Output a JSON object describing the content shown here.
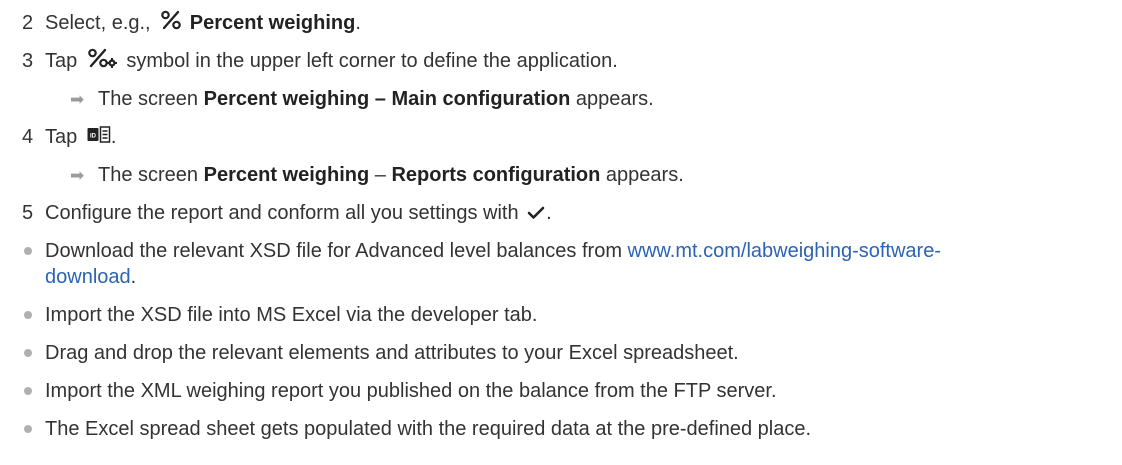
{
  "steps": [
    {
      "number": "2",
      "text_before": "Select, e.g.,",
      "icon": "percent-icon",
      "bold": "Percent weighing",
      "text_after": "."
    },
    {
      "number": "3",
      "text_before": "Tap",
      "icon": "percent-settings-icon",
      "text_after": "symbol in the upper left corner to define the application.",
      "result": {
        "prefix": "The screen",
        "bold": "Percent weighing – Main configuration",
        "suffix": "appears."
      }
    },
    {
      "number": "4",
      "text_before": "Tap",
      "icon": "report-id-icon",
      "text_after": ".",
      "result": {
        "prefix": "The screen",
        "bold_1": "Percent weighing",
        "dash": "–",
        "bold_2": "Reports configuration",
        "suffix": "appears."
      }
    },
    {
      "number": "5",
      "text_before": "Configure the report and conform all you settings with",
      "icon": "checkmark-icon",
      "text_after": "."
    }
  ],
  "bullets": [
    {
      "text_before": "Download the relevant XSD file for Advanced level balances from",
      "link_line1": "www.mt.com/labweighing-software-",
      "link_line2": "download",
      "text_after": "."
    },
    {
      "text": "Import the XSD file into MS Excel via the developer tab."
    },
    {
      "text": "Drag and drop the relevant elements and attributes to your Excel spreadsheet."
    },
    {
      "text": "Import the XML weighing report you published on the balance from the FTP server."
    },
    {
      "text": "The Excel spread sheet gets populated with the required data at the pre-defined place."
    }
  ],
  "colors": {
    "text": "#333333",
    "link": "#2b63b5",
    "arrow": "#9b9b9b",
    "bullet": "#b0b0b0"
  }
}
